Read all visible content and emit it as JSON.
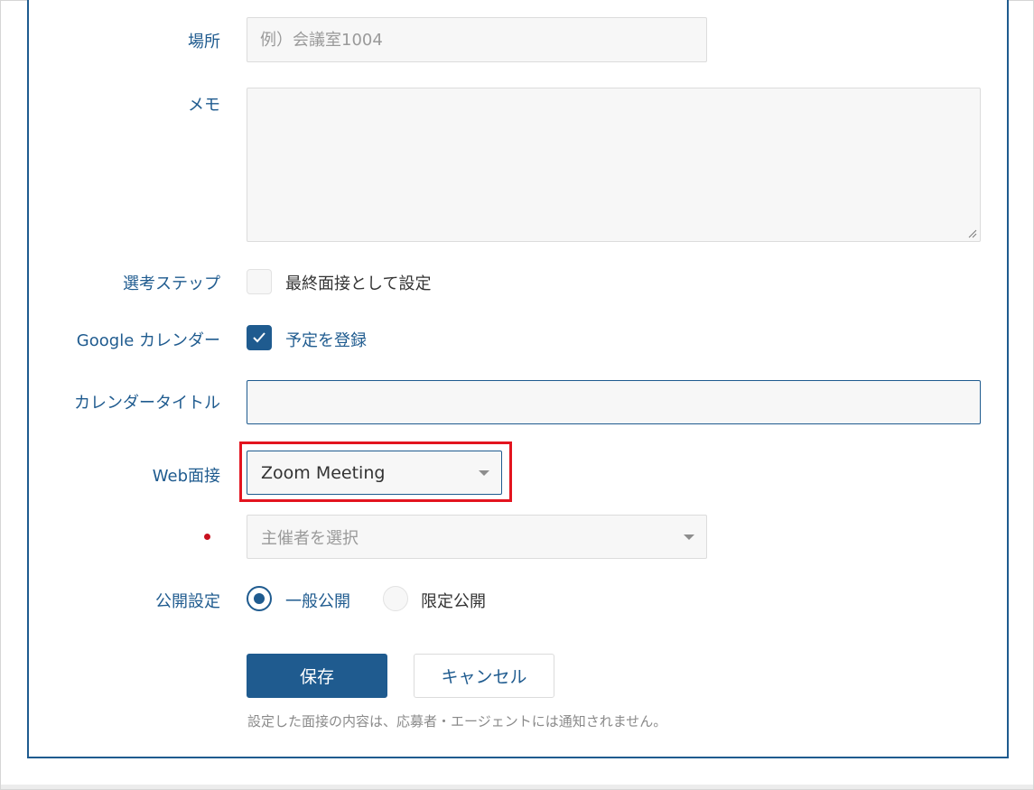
{
  "form": {
    "location": {
      "label": "場所",
      "placeholder": "例）会議室1004"
    },
    "memo": {
      "label": "メモ",
      "value": ""
    },
    "selection_step": {
      "label": "選考ステップ",
      "checkbox_label": "最終面接として設定",
      "checked": false
    },
    "google_calendar": {
      "label": "Google カレンダー",
      "checkbox_label": "予定を登録",
      "checked": true
    },
    "calendar_title": {
      "label": "カレンダータイトル",
      "value": ""
    },
    "web_interview": {
      "label": "Web面接",
      "selected": "Zoom Meeting"
    },
    "host": {
      "placeholder": "主催者を選択"
    },
    "visibility": {
      "label": "公開設定",
      "options": [
        {
          "label": "一般公開",
          "selected": true
        },
        {
          "label": "限定公開",
          "selected": false
        }
      ]
    }
  },
  "actions": {
    "save_label": "保存",
    "cancel_label": "キャンセル"
  },
  "note": "設定した面接の内容は、応募者・エージェントには通知されません。",
  "colors": {
    "accent": "#1f5b8f",
    "highlight": "#e3141f",
    "required": "#c8101e"
  }
}
